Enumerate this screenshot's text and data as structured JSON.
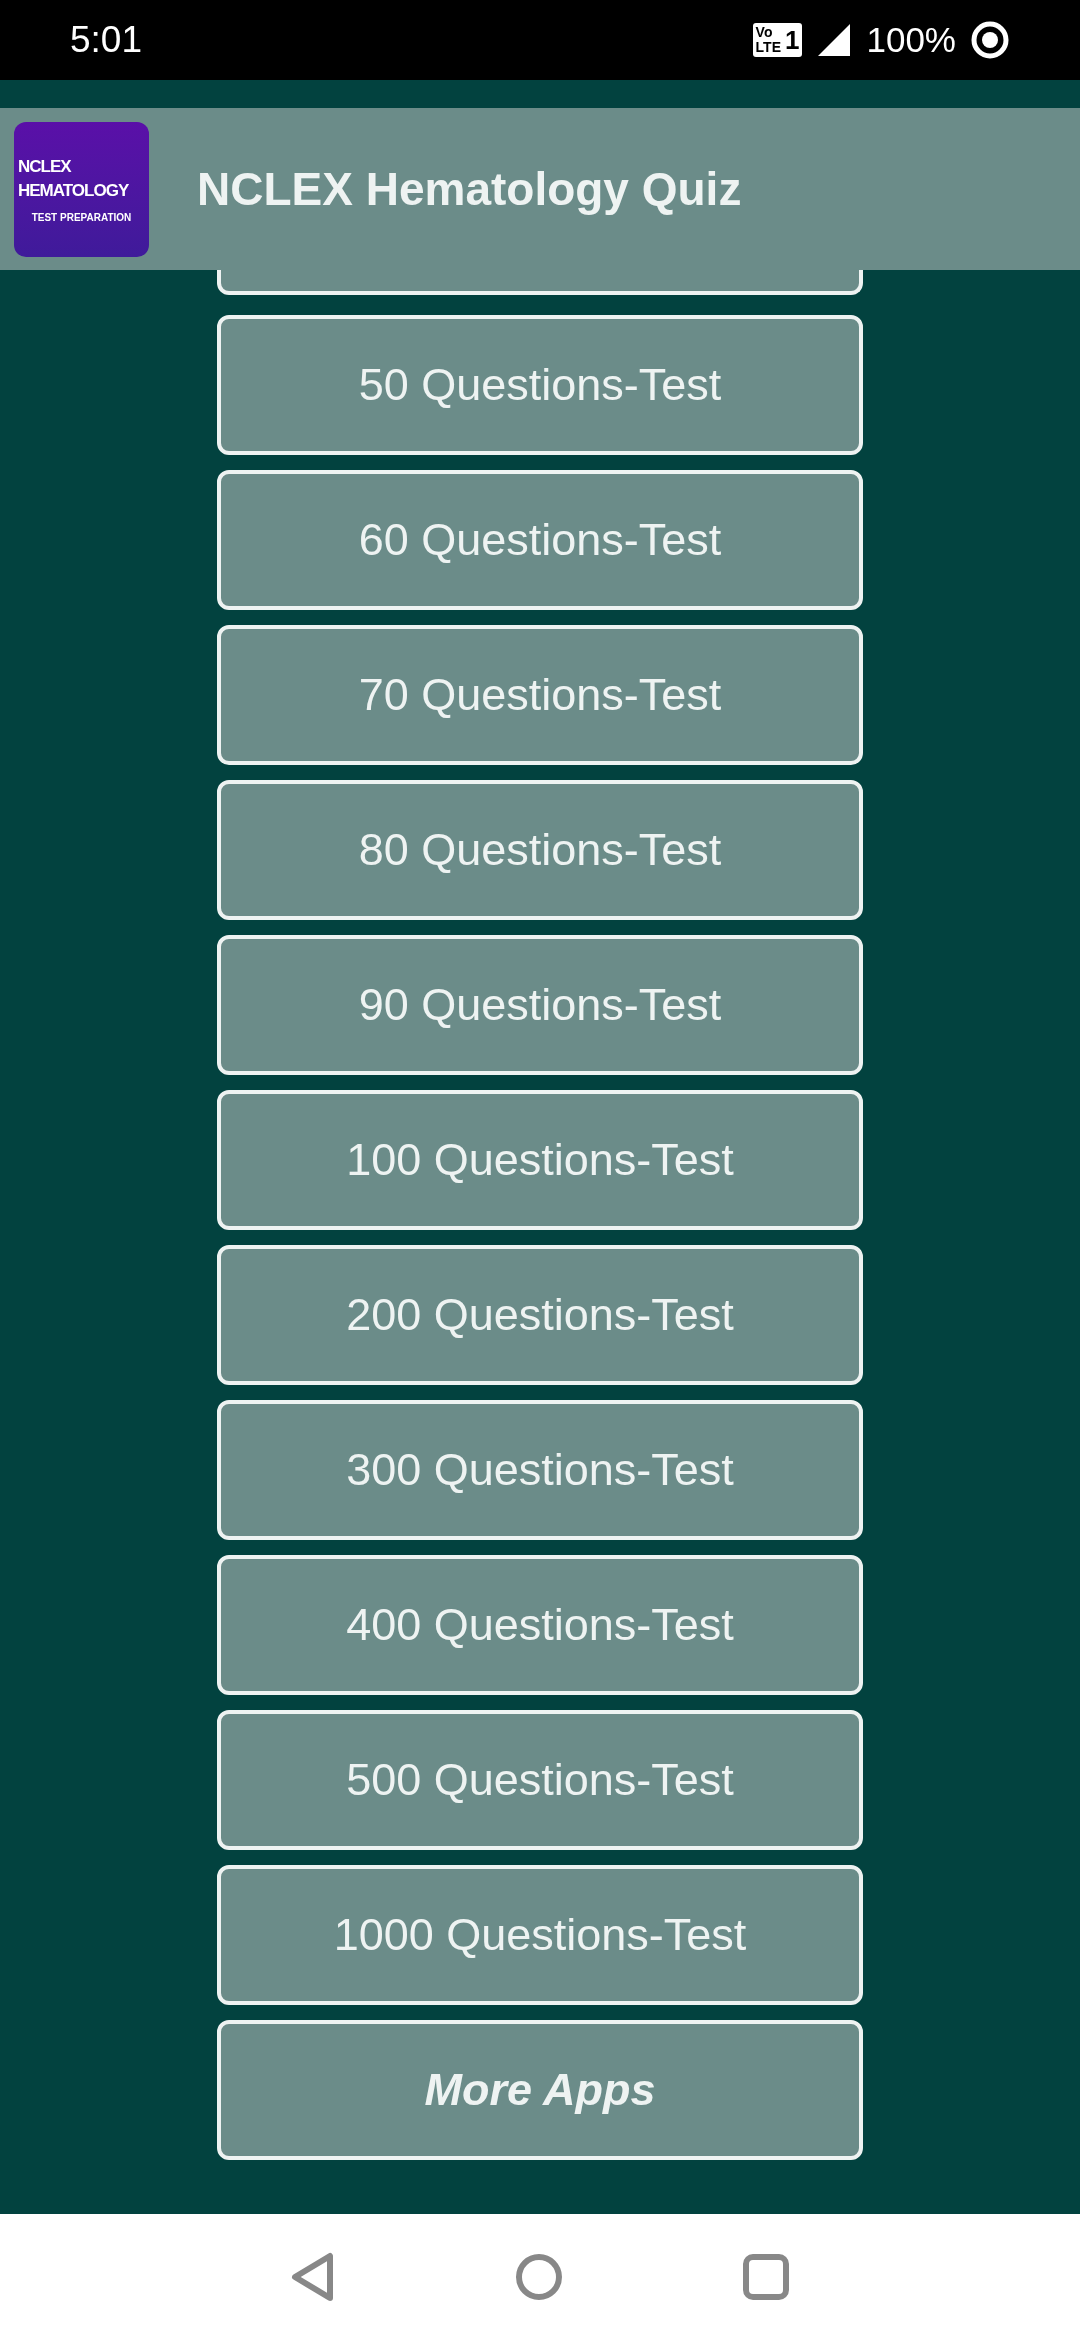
{
  "status_bar": {
    "time": "5:01",
    "volte": [
      "Vo",
      "LTE"
    ],
    "sim": "1",
    "battery": "100%"
  },
  "app_bar": {
    "logo": [
      "NCLEX",
      "HEMATOLOGY",
      "TEST PREPARATION"
    ],
    "title": "NCLEX Hematology Quiz"
  },
  "buttons": [
    {
      "label": "50 Questions-Test",
      "kind": "test"
    },
    {
      "label": "60 Questions-Test",
      "kind": "test"
    },
    {
      "label": "70 Questions-Test",
      "kind": "test"
    },
    {
      "label": "80 Questions-Test",
      "kind": "test"
    },
    {
      "label": "90 Questions-Test",
      "kind": "test"
    },
    {
      "label": "100 Questions-Test",
      "kind": "test"
    },
    {
      "label": "200 Questions-Test",
      "kind": "test"
    },
    {
      "label": "300 Questions-Test",
      "kind": "test"
    },
    {
      "label": "400 Questions-Test",
      "kind": "test"
    },
    {
      "label": "500 Questions-Test",
      "kind": "test"
    },
    {
      "label": "1000 Questions-Test",
      "kind": "test"
    },
    {
      "label": "More Apps",
      "kind": "more"
    }
  ]
}
